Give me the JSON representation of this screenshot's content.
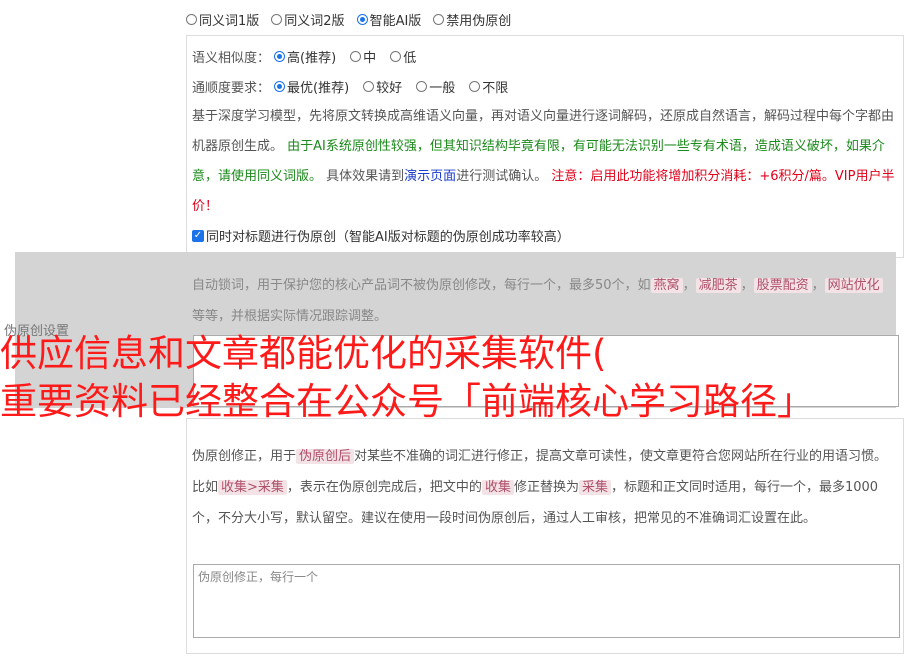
{
  "versions": [
    {
      "label": "同义词1版",
      "selected": false
    },
    {
      "label": "同义词2版",
      "selected": false
    },
    {
      "label": "智能AI版",
      "selected": true
    },
    {
      "label": "禁用伪原创",
      "selected": false
    }
  ],
  "similarity": {
    "label": "语义相似度：",
    "options": [
      "高(推荐)",
      "中",
      "低"
    ]
  },
  "fluency": {
    "label": "通顺度要求：",
    "options": [
      "最优(推荐)",
      "较好",
      "一般",
      "不限"
    ]
  },
  "description": {
    "part1": "基于深度学习模型，先将原文转换成高维语义向量，再对语义向量进行逐词解码，还原成自然语言，解码过程中每个字都由机器原创生成。",
    "part2": "由于AI系统原创性较强，但其知识结构毕竟有限，有可能无法识别一些专有术语，造成语义破坏，如果介意，请使用同义词版。",
    "part3": "具体效果请到",
    "link": "演示页面",
    "part4": "进行测试确认。",
    "warning": "注意：启用此功能将增加积分消耗：+6积分/篇。VIP用户半价！"
  },
  "title_checkbox": {
    "label": "同时对标题进行伪原创（智能AI版对标题的伪原创成功率较高）",
    "checked": true
  },
  "left_label": "伪原创设置",
  "lock": {
    "text1": "自动锁词，用于保护您的核心产品词不被伪原创修改，每行一个，最多50个，如",
    "tags": [
      "燕窝",
      "减肥茶",
      "股票配资",
      "网站优化"
    ],
    "text2": "等等，并根据实际情况跟踪调整。"
  },
  "overlay": {
    "line1": "供应信息和文章都能优化的采集软件(",
    "line2": "重要资料已经整合在公众号「前端核心学习路径」"
  },
  "correction": {
    "t1": "伪原创修正，用于",
    "tag1": "伪原创后",
    "t2": "对某些不准确的词汇进行修正，提高文章可读性，使文章更符合您网站所在行业的用语习惯。比如",
    "tag2": "收集>采集",
    "t3": "，表示在伪原创完成后，把文中的",
    "tag3": "收集",
    "t4": "修正替换为",
    "tag4": "采集",
    "t5": "，标题和正文同时适用，每行一个，最多1000个，不分大小写，默认留空。建议在使用一段时间伪原创后，通过人工审核，把常见的不准确词汇设置在此。",
    "placeholder": "伪原创修正，每行一个"
  }
}
